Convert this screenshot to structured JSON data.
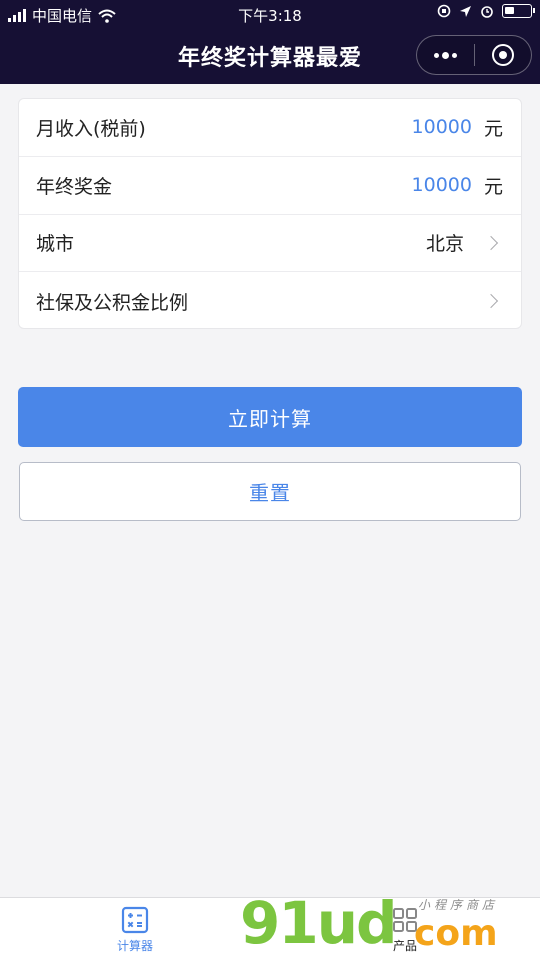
{
  "status_bar": {
    "carrier": "中国电信",
    "time": "下午3:18"
  },
  "nav": {
    "title": "年终奖计算器最爱"
  },
  "form": {
    "rows": [
      {
        "label": "月收入(税前)",
        "value": "10000",
        "unit": "元"
      },
      {
        "label": "年终奖金",
        "value": "10000",
        "unit": "元"
      },
      {
        "label": "城市",
        "selected": "北京"
      },
      {
        "label": "社保及公积金比例",
        "selected": ""
      }
    ]
  },
  "buttons": {
    "calculate": "立即计算",
    "reset": "重置"
  },
  "tabbar": {
    "tabs": [
      {
        "label": "计算器",
        "icon": "calculator-icon",
        "active": true
      },
      {
        "label": "产品",
        "icon": "products-icon",
        "active": false
      }
    ]
  },
  "watermark": {
    "main": "91ud",
    "com": "com",
    "sub": "小程序商店"
  },
  "colors": {
    "header_bg": "#161034",
    "accent": "#4a86e8",
    "page_bg": "#f4f4f6"
  }
}
